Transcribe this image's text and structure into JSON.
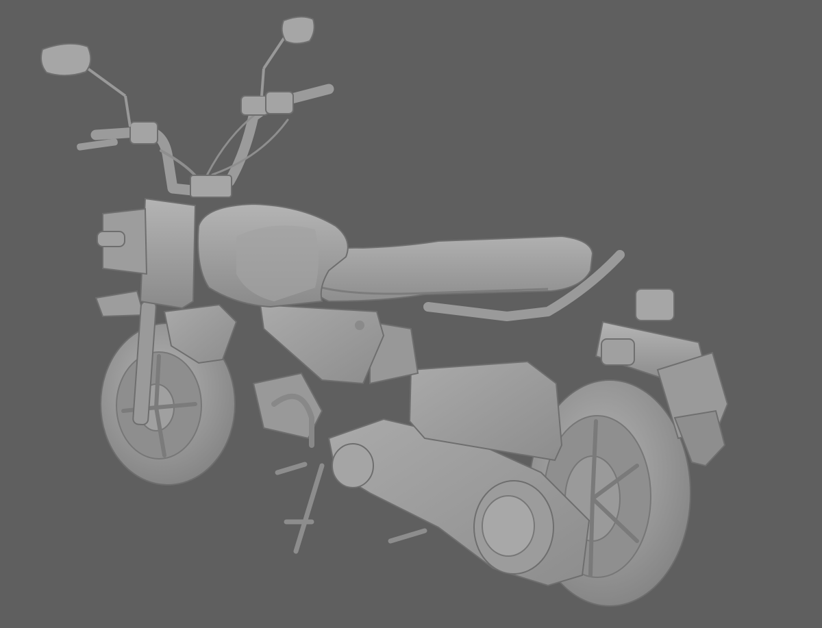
{
  "scene": {
    "subject": "motorcycle-3d-clay-render",
    "background_color": "#5f5f5f",
    "model_color": "#9c9c9c",
    "shadow_color": "#6e6e6e",
    "highlight_color": "#bdbdbd"
  }
}
